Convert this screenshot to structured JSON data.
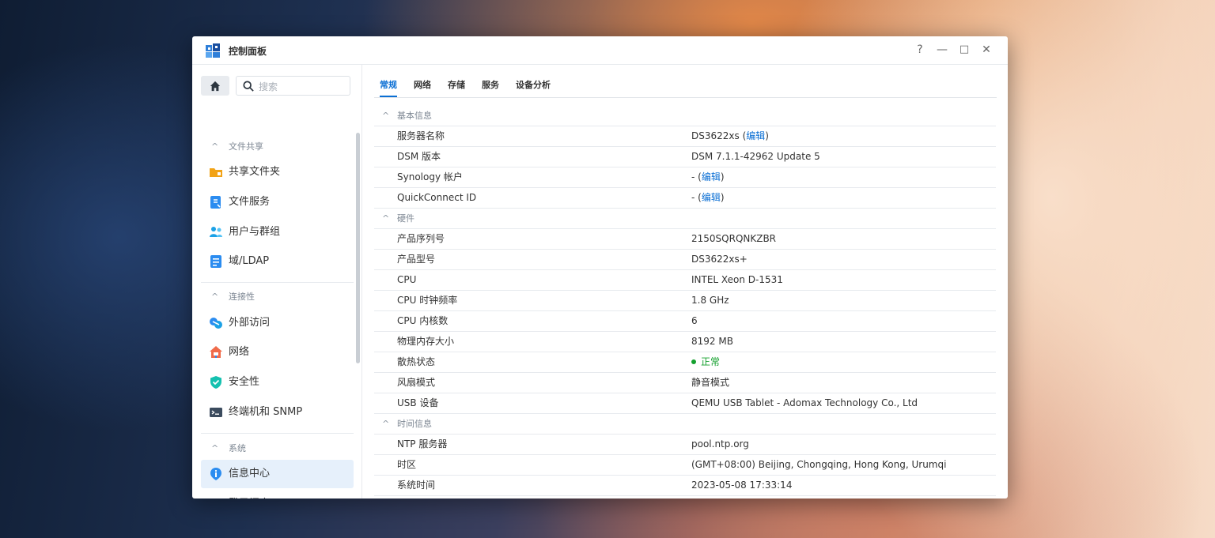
{
  "window": {
    "title": "控制面板",
    "buttons": [
      "?",
      "—",
      "□",
      "✕"
    ]
  },
  "sidebar": {
    "search_placeholder": "搜索",
    "sections": [
      {
        "title": "文件共享",
        "items": [
          {
            "label": "共享文件夹",
            "icon": "shared-folder-icon"
          },
          {
            "label": "文件服务",
            "icon": "file-services-icon"
          },
          {
            "label": "用户与群组",
            "icon": "users-groups-icon"
          },
          {
            "label": "域/LDAP",
            "icon": "domain-ldap-icon"
          }
        ]
      },
      {
        "title": "连接性",
        "items": [
          {
            "label": "外部访问",
            "icon": "external-access-icon"
          },
          {
            "label": "网络",
            "icon": "network-icon"
          },
          {
            "label": "安全性",
            "icon": "security-icon"
          },
          {
            "label": "终端机和 SNMP",
            "icon": "terminal-snmp-icon"
          }
        ]
      },
      {
        "title": "系统",
        "items": [
          {
            "label": "信息中心",
            "icon": "info-center-icon",
            "active": true
          },
          {
            "label": "登录门户",
            "icon": "login-portal-icon"
          }
        ]
      }
    ]
  },
  "tabs": [
    {
      "label": "常规",
      "active": true
    },
    {
      "label": "网络"
    },
    {
      "label": "存储"
    },
    {
      "label": "服务"
    },
    {
      "label": "设备分析"
    }
  ],
  "info": {
    "groups": [
      {
        "title": "基本信息",
        "rows": [
          {
            "key": "服务器名称",
            "value": "DS3622xs",
            "link": "编辑"
          },
          {
            "key": "DSM 版本",
            "value": "DSM 7.1.1-42962 Update 5"
          },
          {
            "key": "Synology 帐户",
            "value": "-",
            "link": "编辑"
          },
          {
            "key": "QuickConnect ID",
            "value": "-",
            "link": "编辑"
          }
        ]
      },
      {
        "title": "硬件",
        "rows": [
          {
            "key": "产品序列号",
            "value": "2150SQRQNKZBR"
          },
          {
            "key": "产品型号",
            "value": "DS3622xs+"
          },
          {
            "key": "CPU",
            "value": "INTEL Xeon D-1531"
          },
          {
            "key": "CPU 时钟频率",
            "value": "1.8 GHz"
          },
          {
            "key": "CPU 内核数",
            "value": "6"
          },
          {
            "key": "物理内存大小",
            "value": "8192 MB"
          },
          {
            "key": "散热状态",
            "value": "正常",
            "status": "ok"
          },
          {
            "key": "风扇模式",
            "value": "静音模式"
          },
          {
            "key": "USB 设备",
            "value": "QEMU USB Tablet - Adomax Technology Co., Ltd"
          }
        ]
      },
      {
        "title": "时间信息",
        "rows": [
          {
            "key": "NTP 服务器",
            "value": "pool.ntp.org"
          },
          {
            "key": "时区",
            "value": "(GMT+08:00) Beijing, Chongqing, Hong Kong, Urumqi"
          },
          {
            "key": "系统时间",
            "value": "2023-05-08 17:33:14"
          }
        ]
      }
    ]
  },
  "colors": {
    "accent": "#0b6fd4",
    "active_bg": "#e6f0fb",
    "status_ok": "#14a02e"
  }
}
